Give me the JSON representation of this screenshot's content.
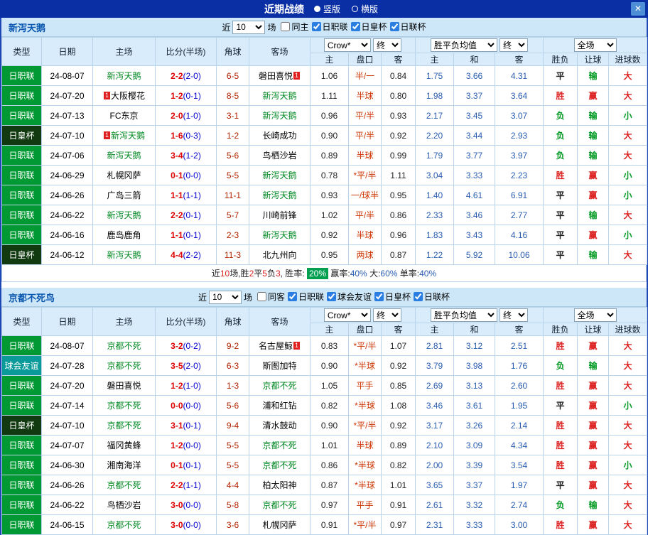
{
  "titlebar": {
    "title": "近期战绩",
    "radios": [
      {
        "label": "竖版",
        "selected": true
      },
      {
        "label": "横版",
        "selected": false
      }
    ],
    "close_label": "✕"
  },
  "colors": {
    "titlebar_bg": "#0a2ea4",
    "accent": "#2a7de1",
    "type_bg": {
      "日职联": "#009933",
      "日皇杯": "#123a10",
      "球会友谊": "#0a9a9a"
    },
    "result": {
      "胜": "#dd2222",
      "平": "#222222",
      "负": "#009922",
      "赢": "#dd2222",
      "输": "#009922",
      "大": "#dd2222",
      "小": "#009922"
    }
  },
  "sections": [
    {
      "team": "新泻天鹅",
      "filter": {
        "near_label": "近",
        "count": "10",
        "games_label": "场",
        "checkboxes": [
          {
            "label": "同主",
            "checked": false
          },
          {
            "label": "日职联",
            "checked": true
          },
          {
            "label": "日皇杯",
            "checked": true
          },
          {
            "label": "日联杯",
            "checked": true
          }
        ]
      },
      "header": {
        "type": "类型",
        "date": "日期",
        "home": "主场",
        "score": "比分(半场)",
        "corner": "角球",
        "away": "客场",
        "odds_source": "Crow*",
        "odds_final": "终",
        "odds_cols": [
          "主",
          "盘口",
          "客"
        ],
        "avg_source": "胜平负均值",
        "avg_final": "终",
        "avg_cols": [
          "主",
          "和",
          "客"
        ],
        "scope": "全场",
        "result_cols": [
          "胜负",
          "让球",
          "进球数"
        ]
      },
      "rows": [
        {
          "type": "日职联",
          "date": "24-08-07",
          "home": {
            "name": "新泻天鹅",
            "focus": true
          },
          "away": {
            "name": "磐田喜悦",
            "badge": "1",
            "badge_side": "after"
          },
          "score": "2-2",
          "half": "(2-0)",
          "corner": "6-5",
          "odds": [
            "1.06",
            "半/一",
            "0.84"
          ],
          "avg": [
            "1.75",
            "3.66",
            "4.31"
          ],
          "result": "平",
          "handicap": "输",
          "goals": "大"
        },
        {
          "type": "日职联",
          "date": "24-07-20",
          "home": {
            "name": "大阪樱花",
            "badge": "1",
            "badge_side": "before"
          },
          "away": {
            "name": "新泻天鹅",
            "focus": true
          },
          "score": "1-2",
          "half": "(0-1)",
          "corner": "8-5",
          "odds": [
            "1.11",
            "半球",
            "0.80"
          ],
          "avg": [
            "1.98",
            "3.37",
            "3.64"
          ],
          "result": "胜",
          "handicap": "赢",
          "goals": "大"
        },
        {
          "type": "日职联",
          "date": "24-07-13",
          "home": {
            "name": "FC东京"
          },
          "away": {
            "name": "新泻天鹅",
            "focus": true
          },
          "score": "2-0",
          "half": "(1-0)",
          "corner": "3-1",
          "odds": [
            "0.96",
            "平/半",
            "0.93"
          ],
          "avg": [
            "2.17",
            "3.45",
            "3.07"
          ],
          "result": "负",
          "handicap": "输",
          "goals": "小"
        },
        {
          "type": "日皇杯",
          "date": "24-07-10",
          "home": {
            "name": "新泻天鹅",
            "focus": true,
            "badge": "1",
            "badge_side": "before"
          },
          "away": {
            "name": "长崎成功"
          },
          "score": "1-6",
          "half": "(0-3)",
          "corner": "1-2",
          "odds": [
            "0.90",
            "平/半",
            "0.92"
          ],
          "avg": [
            "2.20",
            "3.44",
            "2.93"
          ],
          "result": "负",
          "handicap": "输",
          "goals": "大"
        },
        {
          "type": "日职联",
          "date": "24-07-06",
          "home": {
            "name": "新泻天鹅",
            "focus": true
          },
          "away": {
            "name": "鸟栖沙岩"
          },
          "score": "3-4",
          "half": "(1-2)",
          "corner": "5-6",
          "odds": [
            "0.89",
            "半球",
            "0.99"
          ],
          "avg": [
            "1.79",
            "3.77",
            "3.97"
          ],
          "result": "负",
          "handicap": "输",
          "goals": "大"
        },
        {
          "type": "日职联",
          "date": "24-06-29",
          "home": {
            "name": "札幌冈萨"
          },
          "away": {
            "name": "新泻天鹅",
            "focus": true
          },
          "score": "0-1",
          "half": "(0-0)",
          "corner": "5-5",
          "odds": [
            "0.78",
            "*平/半",
            "1.11"
          ],
          "avg": [
            "3.04",
            "3.33",
            "2.23"
          ],
          "result": "胜",
          "handicap": "赢",
          "goals": "小"
        },
        {
          "type": "日职联",
          "date": "24-06-26",
          "home": {
            "name": "广岛三箭"
          },
          "away": {
            "name": "新泻天鹅",
            "focus": true
          },
          "score": "1-1",
          "half": "(1-1)",
          "corner": "11-1",
          "odds": [
            "0.93",
            "一/球半",
            "0.95"
          ],
          "avg": [
            "1.40",
            "4.61",
            "6.91"
          ],
          "result": "平",
          "handicap": "赢",
          "goals": "小"
        },
        {
          "type": "日职联",
          "date": "24-06-22",
          "home": {
            "name": "新泻天鹅",
            "focus": true
          },
          "away": {
            "name": "川崎前锋"
          },
          "score": "2-2",
          "half": "(0-1)",
          "corner": "5-7",
          "odds": [
            "1.02",
            "平/半",
            "0.86"
          ],
          "avg": [
            "2.33",
            "3.46",
            "2.77"
          ],
          "result": "平",
          "handicap": "输",
          "goals": "大"
        },
        {
          "type": "日职联",
          "date": "24-06-16",
          "home": {
            "name": "鹿岛鹿角"
          },
          "away": {
            "name": "新泻天鹅",
            "focus": true
          },
          "score": "1-1",
          "half": "(0-1)",
          "corner": "2-3",
          "odds": [
            "0.92",
            "半球",
            "0.96"
          ],
          "avg": [
            "1.83",
            "3.43",
            "4.16"
          ],
          "result": "平",
          "handicap": "赢",
          "goals": "小"
        },
        {
          "type": "日皇杯",
          "date": "24-06-12",
          "home": {
            "name": "新泻天鹅",
            "focus": true
          },
          "away": {
            "name": "北九州向"
          },
          "score": "4-4",
          "half": "(2-2)",
          "corner": "11-3",
          "odds": [
            "0.95",
            "两球",
            "0.87"
          ],
          "avg": [
            "1.22",
            "5.92",
            "10.06"
          ],
          "result": "平",
          "handicap": "输",
          "goals": "大"
        }
      ],
      "summary": [
        {
          "text": "近",
          "color": "#222222"
        },
        {
          "text": "10",
          "color": "#dd2222"
        },
        {
          "text": "场,胜",
          "color": "#222222"
        },
        {
          "text": "2",
          "color": "#dd2222"
        },
        {
          "text": "平",
          "color": "#222222"
        },
        {
          "text": "5",
          "color": "#dd2222"
        },
        {
          "text": "负",
          "color": "#222222"
        },
        {
          "text": "3",
          "color": "#dd2222"
        },
        {
          "text": ", 胜率: ",
          "color": "#222222"
        },
        {
          "text": "20%",
          "color": "#ffffff",
          "bg": "#00a050"
        },
        {
          "text": " 赢率:",
          "color": "#222222"
        },
        {
          "text": "40%",
          "color": "#2a5db0"
        },
        {
          "text": " 大:",
          "color": "#222222"
        },
        {
          "text": "60%",
          "color": "#2a5db0"
        },
        {
          "text": " 单率:",
          "color": "#222222"
        },
        {
          "text": "40%",
          "color": "#2a5db0"
        }
      ]
    },
    {
      "team": "京都不死鸟",
      "filter": {
        "near_label": "近",
        "count": "10",
        "games_label": "场",
        "checkboxes": [
          {
            "label": "同客",
            "checked": false
          },
          {
            "label": "日职联",
            "checked": true
          },
          {
            "label": "球会友谊",
            "checked": true
          },
          {
            "label": "日皇杯",
            "checked": true
          },
          {
            "label": "日联杯",
            "checked": true
          }
        ]
      },
      "header": {
        "type": "类型",
        "date": "日期",
        "home": "主场",
        "score": "比分(半场)",
        "corner": "角球",
        "away": "客场",
        "odds_source": "Crow*",
        "odds_final": "终",
        "odds_cols": [
          "主",
          "盘口",
          "客"
        ],
        "avg_source": "胜平负均值",
        "avg_final": "终",
        "avg_cols": [
          "主",
          "和",
          "客"
        ],
        "scope": "全场",
        "result_cols": [
          "胜负",
          "让球",
          "进球数"
        ]
      },
      "rows": [
        {
          "type": "日职联",
          "date": "24-08-07",
          "home": {
            "name": "京都不死",
            "focus": true
          },
          "away": {
            "name": "名古屋鲸",
            "badge": "1",
            "badge_side": "after"
          },
          "score": "3-2",
          "half": "(0-2)",
          "corner": "9-2",
          "odds": [
            "0.83",
            "*平/半",
            "1.07"
          ],
          "avg": [
            "2.81",
            "3.12",
            "2.51"
          ],
          "result": "胜",
          "handicap": "赢",
          "goals": "大"
        },
        {
          "type": "球会友谊",
          "date": "24-07-28",
          "home": {
            "name": "京都不死",
            "focus": true
          },
          "away": {
            "name": "斯图加特"
          },
          "score": "3-5",
          "half": "(2-0)",
          "corner": "6-3",
          "odds": [
            "0.90",
            "*半球",
            "0.92"
          ],
          "avg": [
            "3.79",
            "3.98",
            "1.76"
          ],
          "result": "负",
          "handicap": "输",
          "goals": "大"
        },
        {
          "type": "日职联",
          "date": "24-07-20",
          "home": {
            "name": "磐田喜悦"
          },
          "away": {
            "name": "京都不死",
            "focus": true
          },
          "score": "1-2",
          "half": "(1-0)",
          "corner": "1-3",
          "odds": [
            "1.05",
            "平手",
            "0.85"
          ],
          "avg": [
            "2.69",
            "3.13",
            "2.60"
          ],
          "result": "胜",
          "handicap": "赢",
          "goals": "大"
        },
        {
          "type": "日职联",
          "date": "24-07-14",
          "home": {
            "name": "京都不死",
            "focus": true
          },
          "away": {
            "name": "浦和红钻"
          },
          "score": "0-0",
          "half": "(0-0)",
          "corner": "5-6",
          "odds": [
            "0.82",
            "*半球",
            "1.08"
          ],
          "avg": [
            "3.46",
            "3.61",
            "1.95"
          ],
          "result": "平",
          "handicap": "赢",
          "goals": "小"
        },
        {
          "type": "日皇杯",
          "date": "24-07-10",
          "home": {
            "name": "京都不死",
            "focus": true
          },
          "away": {
            "name": "清水鼓动"
          },
          "score": "3-1",
          "half": "(0-1)",
          "corner": "9-4",
          "odds": [
            "0.90",
            "*平/半",
            "0.92"
          ],
          "avg": [
            "3.17",
            "3.26",
            "2.14"
          ],
          "result": "胜",
          "handicap": "赢",
          "goals": "大"
        },
        {
          "type": "日职联",
          "date": "24-07-07",
          "home": {
            "name": "福冈黄蜂"
          },
          "away": {
            "name": "京都不死",
            "focus": true
          },
          "score": "1-2",
          "half": "(0-0)",
          "corner": "5-5",
          "odds": [
            "1.01",
            "半球",
            "0.89"
          ],
          "avg": [
            "2.10",
            "3.09",
            "4.34"
          ],
          "result": "胜",
          "handicap": "赢",
          "goals": "大"
        },
        {
          "type": "日职联",
          "date": "24-06-30",
          "home": {
            "name": "湘南海洋"
          },
          "away": {
            "name": "京都不死",
            "focus": true
          },
          "score": "0-1",
          "half": "(0-1)",
          "corner": "5-5",
          "odds": [
            "0.86",
            "*半球",
            "0.82"
          ],
          "avg": [
            "2.00",
            "3.39",
            "3.54"
          ],
          "result": "胜",
          "handicap": "赢",
          "goals": "小"
        },
        {
          "type": "日职联",
          "date": "24-06-26",
          "home": {
            "name": "京都不死",
            "focus": true
          },
          "away": {
            "name": "柏太阳神"
          },
          "score": "2-2",
          "half": "(1-1)",
          "corner": "4-4",
          "odds": [
            "0.87",
            "*半球",
            "1.01"
          ],
          "avg": [
            "3.65",
            "3.37",
            "1.97"
          ],
          "result": "平",
          "handicap": "赢",
          "goals": "大"
        },
        {
          "type": "日职联",
          "date": "24-06-22",
          "home": {
            "name": "鸟栖沙岩"
          },
          "away": {
            "name": "京都不死",
            "focus": true
          },
          "score": "3-0",
          "half": "(0-0)",
          "corner": "5-8",
          "odds": [
            "0.97",
            "平手",
            "0.91"
          ],
          "avg": [
            "2.61",
            "3.32",
            "2.74"
          ],
          "result": "负",
          "handicap": "输",
          "goals": "大"
        },
        {
          "type": "日职联",
          "date": "24-06-15",
          "home": {
            "name": "京都不死",
            "focus": true
          },
          "away": {
            "name": "札幌冈萨"
          },
          "score": "3-0",
          "half": "(0-0)",
          "corner": "3-6",
          "odds": [
            "0.91",
            "*平/半",
            "0.97"
          ],
          "avg": [
            "2.31",
            "3.33",
            "3.00"
          ],
          "result": "胜",
          "handicap": "赢",
          "goals": "大"
        }
      ]
    }
  ]
}
